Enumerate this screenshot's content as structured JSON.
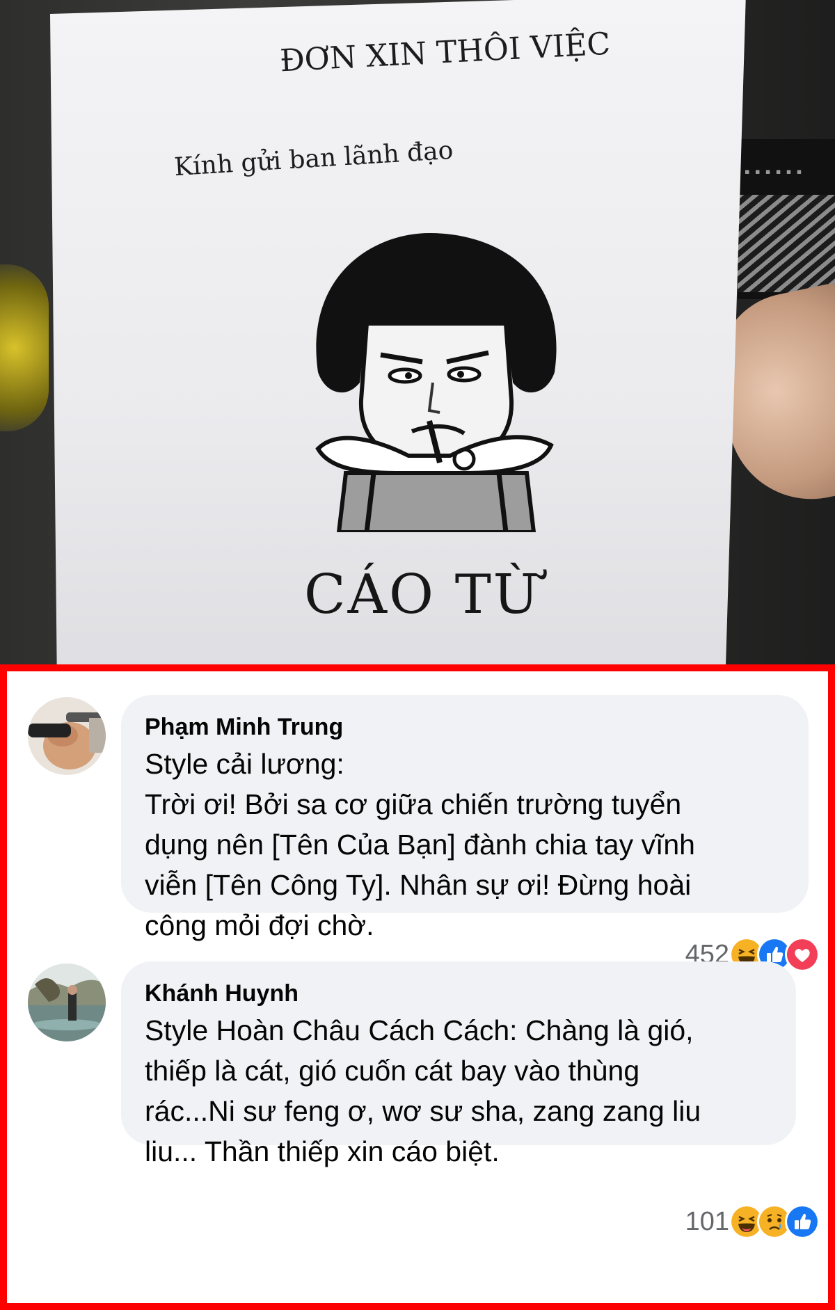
{
  "photo": {
    "paper_title": "ĐƠN XIN THÔI VIỆC",
    "paper_line": "Kính gửi ban lãnh đạo",
    "paper_bottom": "CÁO TỪ"
  },
  "comments": [
    {
      "author": "Phạm Minh Trung",
      "lines": [
        "Style cải lương:",
        "Trời ơi! Bởi sa cơ giữa chiến trường tuyển",
        "dụng nên [Tên Của Bạn]  đành chia tay vĩnh",
        "viễn [Tên Công Ty]. Nhân sự ơi! Đừng hoài",
        "công mỏi đợi chờ."
      ],
      "reaction_count": "452",
      "reactions": [
        "haha-icon",
        "like-icon",
        "love-icon"
      ]
    },
    {
      "author": "Khánh Huynh",
      "lines": [
        "Style Hoàn Châu Cách Cách: Chàng là gió,",
        "thiếp là cát, gió cuốn cát bay vào thùng",
        "rác...Ni sư feng ơ, wơ sư sha, zang zang liu",
        "liu... Thần thiếp xin cáo biệt."
      ],
      "reaction_count": "101",
      "reactions": [
        "haha-icon",
        "sad-icon",
        "like-icon"
      ]
    }
  ],
  "colors": {
    "frame": "#ff0000",
    "bubble": "#f0f2f5",
    "like": "#1877f2",
    "love": "#f33e58",
    "haha": "#f7b125"
  }
}
